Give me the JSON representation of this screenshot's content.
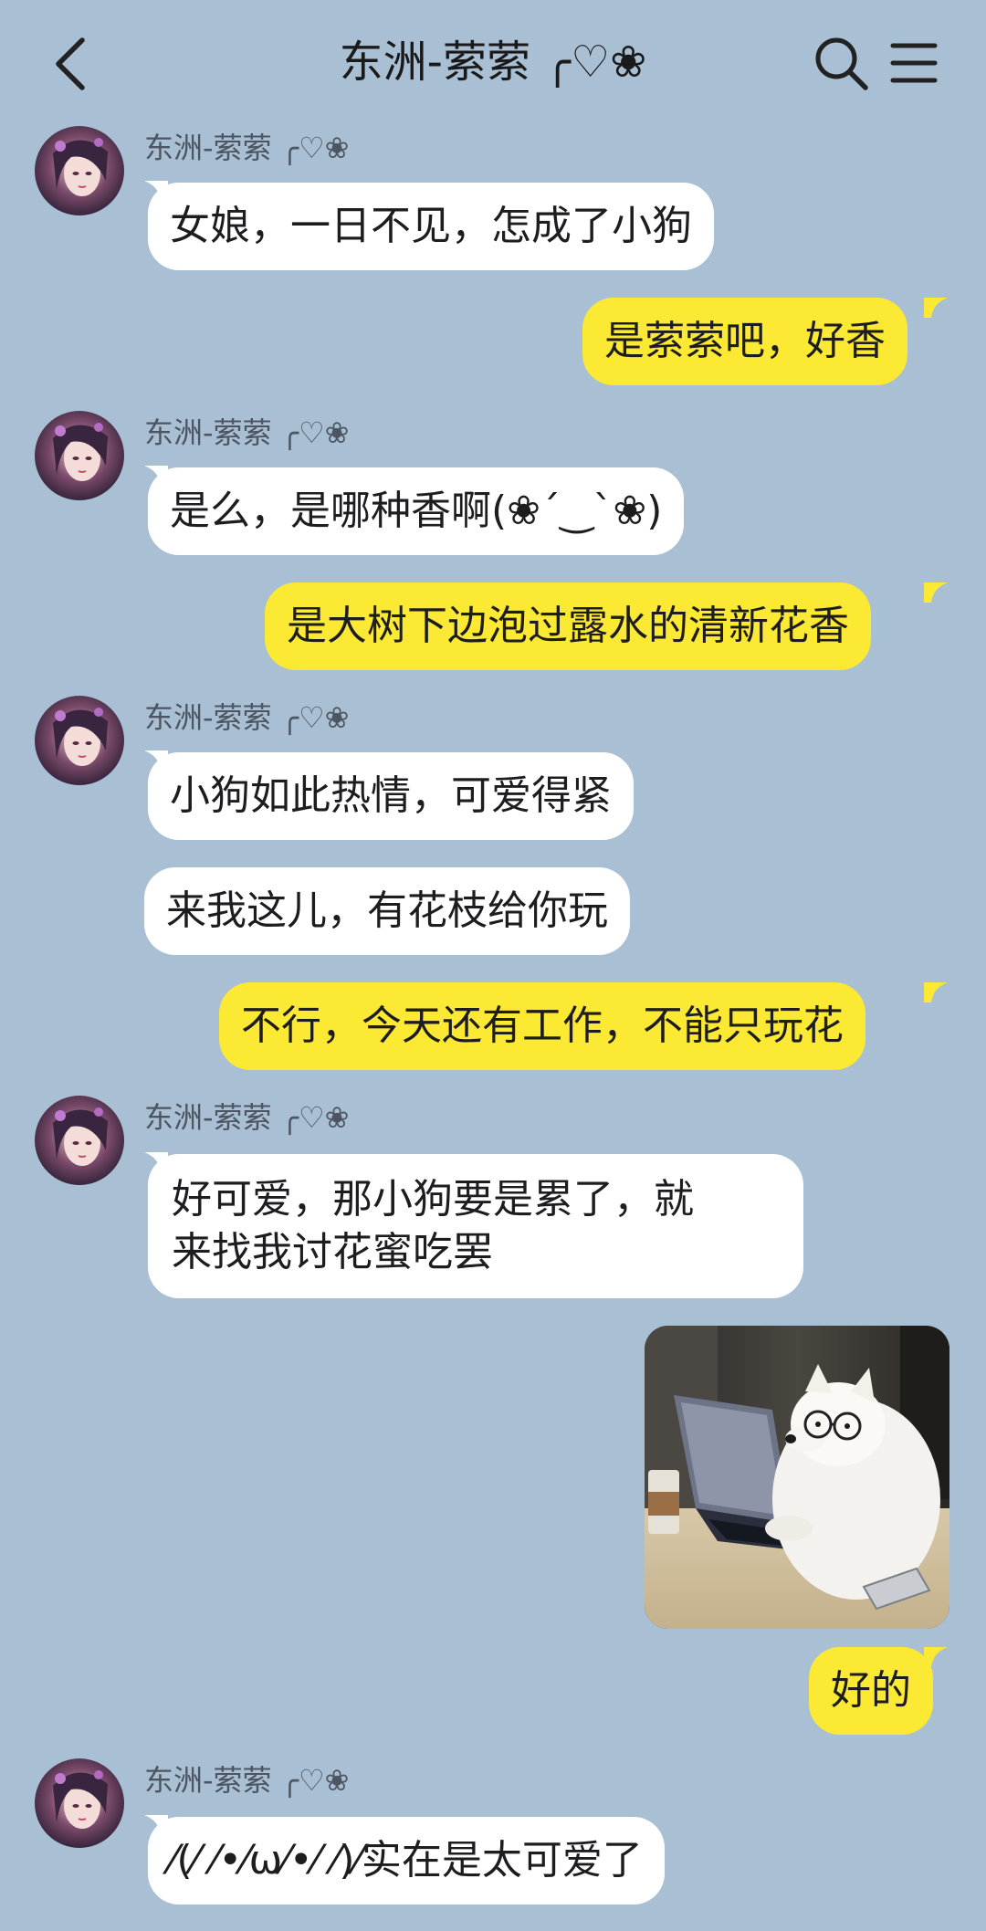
{
  "header": {
    "title": "东洲-萦萦 ╭♡❀"
  },
  "messages": [
    {
      "side": "in",
      "sender": "东洲-萦萦 ╭♡❀",
      "text": "女娘，一日不见，怎成了小狗"
    },
    {
      "side": "out",
      "text": "是萦萦吧，好香"
    },
    {
      "side": "in",
      "sender": "东洲-萦萦 ╭♡❀",
      "text": "是么，是哪种香啊(❀´‿`❀)"
    },
    {
      "side": "out",
      "text": "是大树下边泡过露水的清新花香"
    },
    {
      "side": "in",
      "sender": "东洲-萦萦 ╭♡❀",
      "text": "小狗如此热情，可爱得紧"
    },
    {
      "side": "in",
      "text": "来我这儿，有花枝给你玩"
    },
    {
      "side": "out",
      "text": "不行，今天还有工作，不能只玩花"
    },
    {
      "side": "in",
      "sender": "东洲-萦萦 ╭♡❀",
      "text_line1": "好可爱，那小狗要是累了，就",
      "text_line2": "来找我讨花蜜吃罢"
    },
    {
      "side": "out",
      "type": "image",
      "alt": "dog-at-laptop-photo"
    },
    {
      "side": "out",
      "text": "好的"
    },
    {
      "side": "in",
      "sender": "东洲-萦萦 ╭♡❀",
      "text": "⁄(⁄ ⁄•⁄ω⁄•⁄ ⁄)⁄实在是太可爱了"
    }
  ],
  "icons": {
    "back": "chevron-left-icon",
    "search": "search-icon",
    "menu": "hamburger-menu-icon"
  },
  "colors": {
    "background": "#a9bfd4",
    "incoming_bubble": "#ffffff",
    "outgoing_bubble": "#fbe933"
  }
}
